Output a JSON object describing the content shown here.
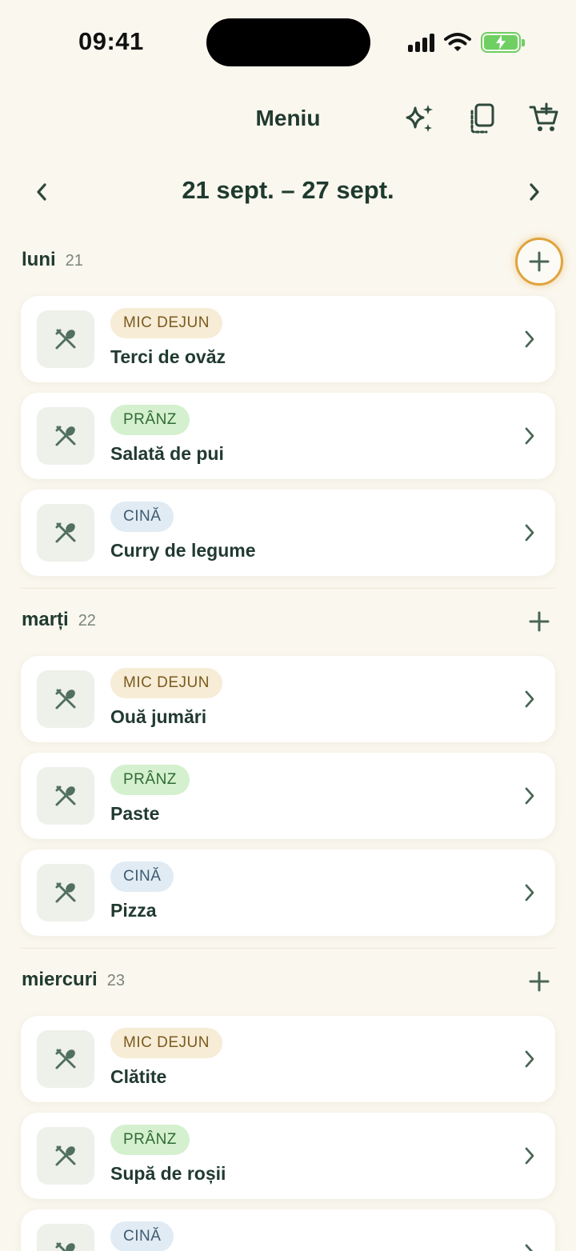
{
  "status_bar": {
    "time": "09:41"
  },
  "nav": {
    "title": "Meniu",
    "icons": [
      "sparkles-icon",
      "copy-icon",
      "cart-add-icon"
    ]
  },
  "week": {
    "label": "21 sept. – 27 sept."
  },
  "days": [
    {
      "name": "luni",
      "date": "21",
      "meals": [
        {
          "type": "MIC DEJUN",
          "name": "Terci de ovăz"
        },
        {
          "type": "PRÂNZ",
          "name": "Salată de pui"
        },
        {
          "type": "CINĂ",
          "name": "Curry de legume"
        }
      ]
    },
    {
      "name": "marți",
      "date": "22",
      "meals": [
        {
          "type": "MIC DEJUN",
          "name": "Ouă jumări"
        },
        {
          "type": "PRÂNZ",
          "name": "Paste"
        },
        {
          "type": "CINĂ",
          "name": "Pizza"
        }
      ]
    },
    {
      "name": "miercuri",
      "date": "23",
      "meals": [
        {
          "type": "MIC DEJUN",
          "name": "Clătite"
        },
        {
          "type": "PRÂNZ",
          "name": "Supă de roșii"
        },
        {
          "type": "CINĂ",
          "name": ""
        }
      ]
    }
  ],
  "colors": {
    "background": "#faf7ee",
    "text": "#213a30",
    "highlight_ring": "#e0a33d",
    "breakfast_badge": "#f7ecd6",
    "lunch_badge": "#d5f0cf",
    "dinner_badge": "#e1ebf3"
  }
}
